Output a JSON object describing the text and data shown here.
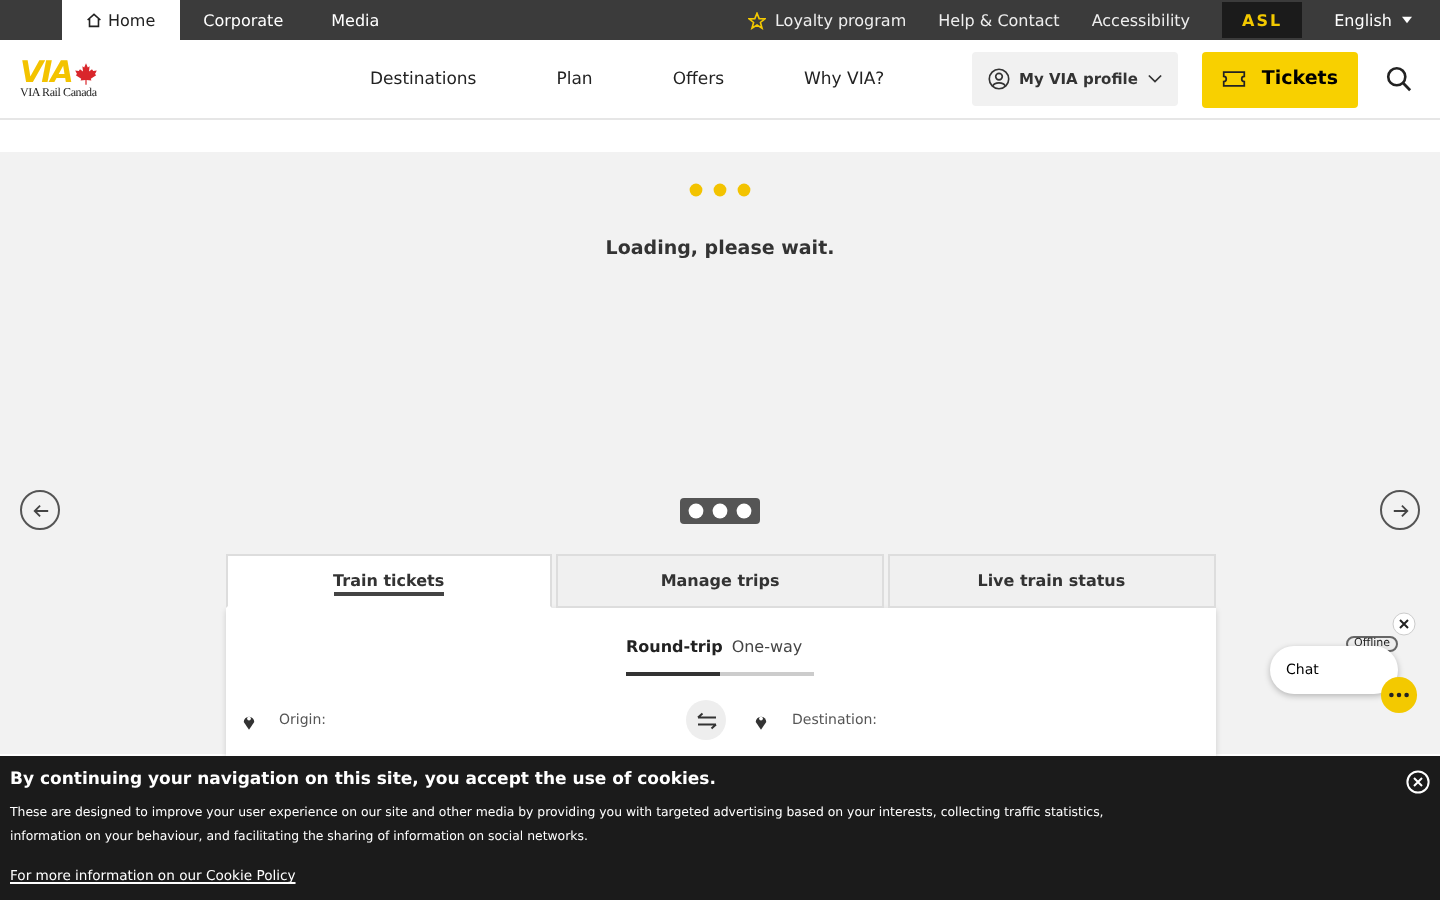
{
  "top_bar": {
    "sections": [
      {
        "label": "Home",
        "selected": true
      },
      {
        "label": "Corporate",
        "selected": false
      },
      {
        "label": "Media",
        "selected": false
      }
    ],
    "links": [
      {
        "label": "Loyalty program",
        "kind": "star"
      },
      {
        "label": "Help & Contact",
        "kind": "plain"
      },
      {
        "label": "Accessibility",
        "kind": "plain"
      }
    ],
    "asl_button": "ASL",
    "language": "English"
  },
  "header": {
    "logo": {
      "wordmark": "VIA",
      "subtitle": "VIA Rail Canada"
    },
    "nav": [
      "Destinations",
      "Plan",
      "Offers",
      "Why VIA?"
    ],
    "profile_button": "My VIA profile",
    "tickets_button": "Tickets"
  },
  "loading": {
    "message": "Loading, please wait."
  },
  "booking": {
    "tabs": [
      {
        "label": "Train tickets",
        "selected": true
      },
      {
        "label": "Manage trips",
        "selected": false
      },
      {
        "label": "Live train status",
        "selected": false
      }
    ],
    "trip_types": [
      {
        "label": "Round-trip",
        "selected": true
      },
      {
        "label": "One-way",
        "selected": false
      }
    ],
    "origin_label": "Origin:",
    "destination_label": "Destination:"
  },
  "chat": {
    "label": "Chat",
    "status": "Offline"
  },
  "cookie_banner": {
    "title": "By continuing your navigation on this site, you accept the use of cookies.",
    "text": "These are designed to improve your user experience on our site and other media by providing you with targeted advertising based on your interests, collecting traffic statistics, information on your behaviour, and facilitating the sharing of information on social networks.",
    "link": "For more information on our Cookie Policy"
  }
}
